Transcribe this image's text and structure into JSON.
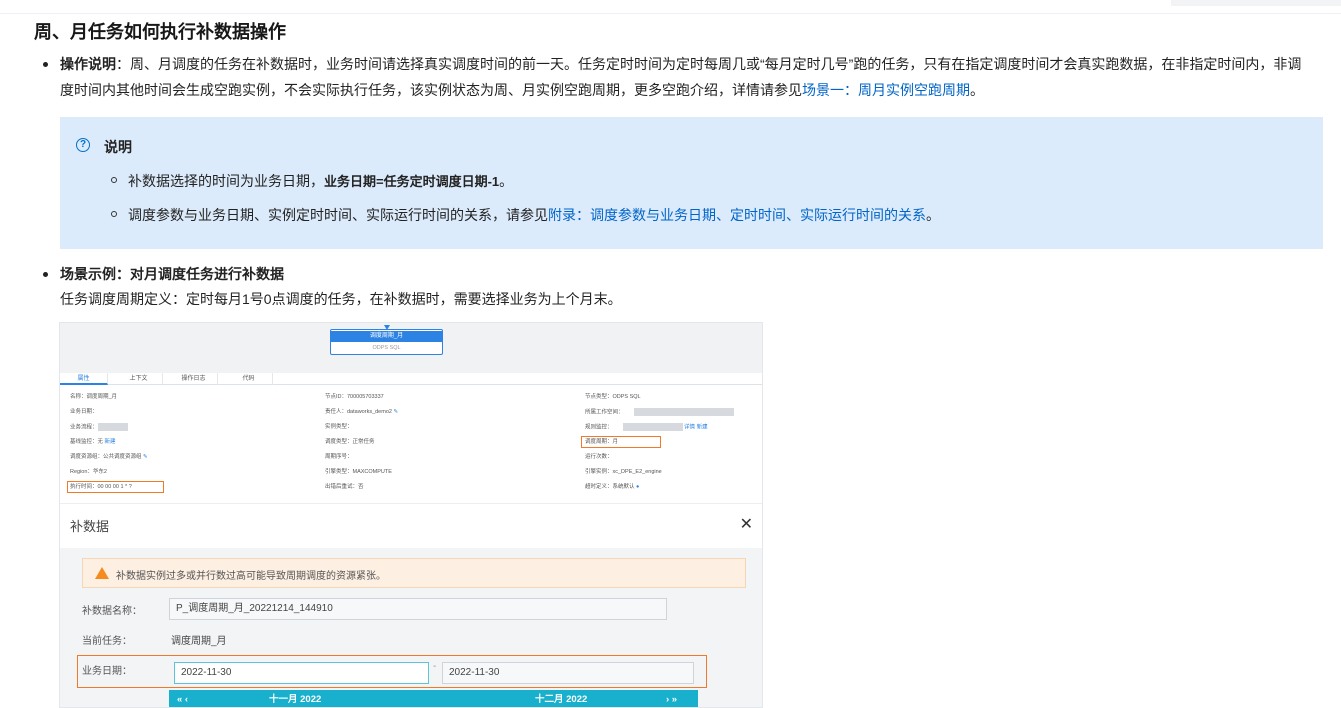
{
  "section": {
    "title": "周、月任务如何执行补数据操作",
    "bullet1": {
      "label": "操作说明",
      "text": "：周、月调度的任务在补数据时，业务时间请选择真实调度时间的前一天。任务定时时间为定时每周几或“每月定时几号”跑的任务，只有在指定调度时间才会真实跑数据，在非指定时间内，非调度时间内其他时间会生成空跑实例，不会实际执行任务，该实例状态为周、月实例空跑周期，更多空跑介绍，详情请参见",
      "link": "场景一：周月实例空跑周期",
      "end": "。"
    },
    "note": {
      "heading": "说明",
      "item1_prefix": "补数据选择的时间为业务日期，",
      "item1_bold": "业务日期=任务定时调度日期-1",
      "item1_suffix": "。",
      "item2_prefix": "调度参数与业务日期、实例定时时间、实际运行时间的关系，请参见",
      "item2_link": "附录：调度参数与业务日期、定时时间、实际运行时间的关系",
      "item2_suffix": "。"
    },
    "bullet2": {
      "label": "场景示例：对月调度任务进行补数据",
      "desc": "任务调度周期定义：定时每月1号0点调度的任务，在补数据时，需要选择业务为上个月末。"
    }
  },
  "screenshot": {
    "node": {
      "title": "调度周期_月",
      "type": "ODPS SQL"
    },
    "tabs": [
      "属性",
      "上下文",
      "操作日志",
      "代码"
    ],
    "props": {
      "name": "名称：调度周期_月",
      "biz_date": "业务日期：",
      "flow": "业务流程：",
      "baseline": "基线监控：无",
      "baseline_new": "新建",
      "resource": "调度资源组：公共调度资源组",
      "region": "Region：华东2",
      "exec_time": "执行时间：00 00 00 1 * ?",
      "node_id": "节点ID：700005703337",
      "owner": "责任人：dataworks_demo2",
      "inst_type": "实例类型：",
      "sched_type": "调度类型：正常任务",
      "cycle_no": "周期序号：",
      "engine_type": "引擎类型：MAXCOMPUTE",
      "retry": "出错后重试：否",
      "node_type": "节点类型：ODPS SQL",
      "workspace": "所属工作空间：",
      "rule_monitor": "规则监控：",
      "detail": "详情",
      "new": "新建",
      "cycle": "调度周期：月",
      "run_count": "运行次数：",
      "engine_inst": "引擎实例：xc_DPE_E2_engine",
      "timeout": "超时定义：系统默认"
    },
    "modal": {
      "title": "补数据",
      "close": "✕",
      "warning": "补数据实例过多或并行数过高可能导致周期调度的资源紧张。",
      "name_label": "补数据名称：",
      "name_value": "P_调度周期_月_20221214_144910",
      "task_label": "当前任务：",
      "task_value": "调度周期_月",
      "date_label": "业务日期：",
      "date_start": "2022-11-30",
      "date_end": "2022-11-30",
      "dash": "-",
      "cal_left": "十一月 2022",
      "cal_right": "十二月 2022",
      "cal_prev": "«  ‹",
      "cal_next": "›  »"
    }
  }
}
